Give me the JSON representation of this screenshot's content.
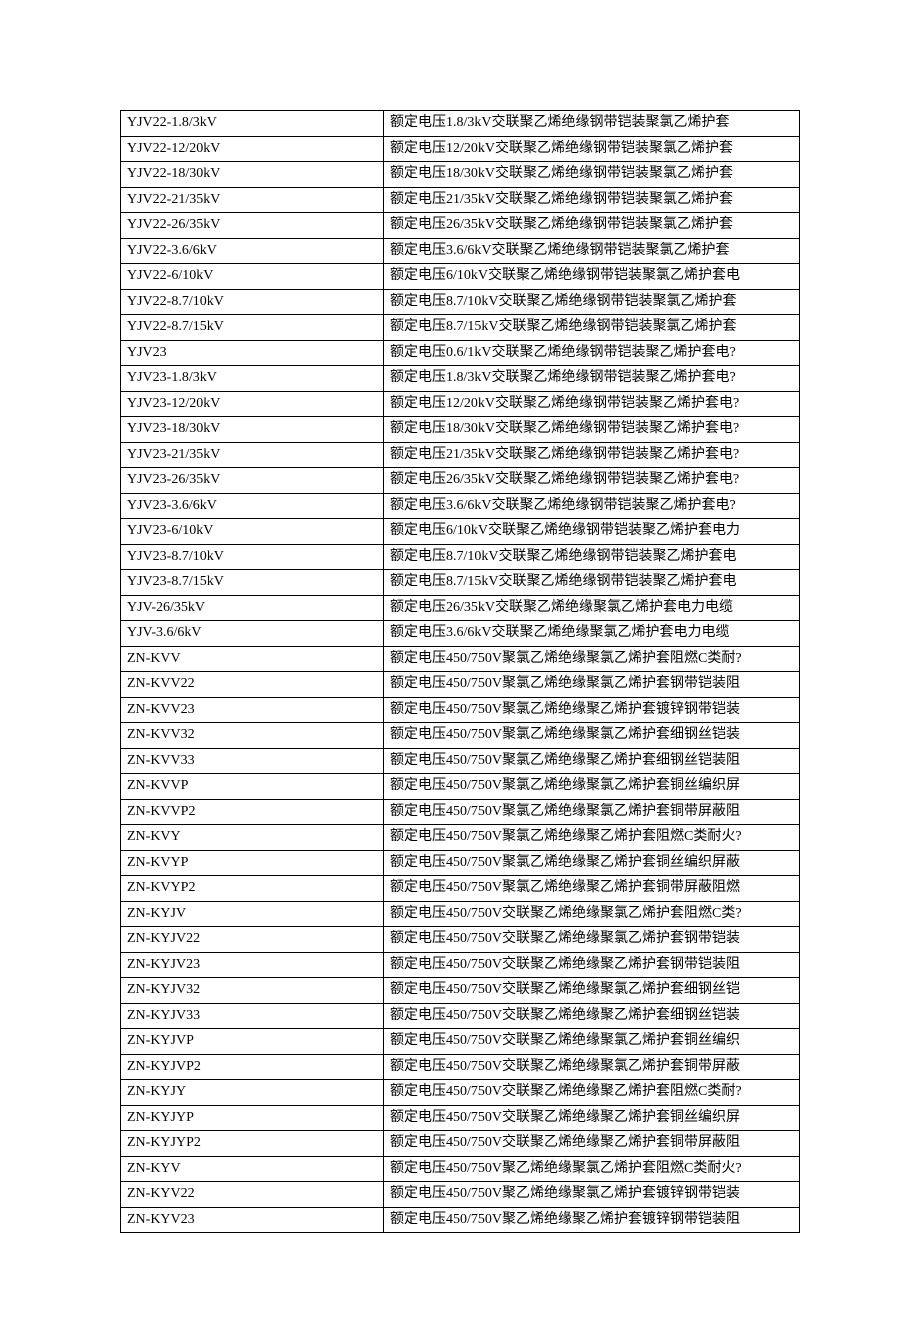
{
  "table": {
    "rows": [
      {
        "code": "YJV22-1.8/3kV",
        "desc": "额定电压1.8/3kV交联聚乙烯绝缘钢带铠装聚氯乙烯护套"
      },
      {
        "code": "YJV22-12/20kV",
        "desc": "额定电压12/20kV交联聚乙烯绝缘钢带铠装聚氯乙烯护套"
      },
      {
        "code": "YJV22-18/30kV",
        "desc": "额定电压18/30kV交联聚乙烯绝缘钢带铠装聚氯乙烯护套"
      },
      {
        "code": "YJV22-21/35kV",
        "desc": "额定电压21/35kV交联聚乙烯绝缘钢带铠装聚氯乙烯护套"
      },
      {
        "code": "YJV22-26/35kV",
        "desc": "额定电压26/35kV交联聚乙烯绝缘钢带铠装聚氯乙烯护套"
      },
      {
        "code": "YJV22-3.6/6kV",
        "desc": "额定电压3.6/6kV交联聚乙烯绝缘钢带铠装聚氯乙烯护套"
      },
      {
        "code": "YJV22-6/10kV",
        "desc": "额定电压6/10kV交联聚乙烯绝缘钢带铠装聚氯乙烯护套电"
      },
      {
        "code": "YJV22-8.7/10kV",
        "desc": "额定电压8.7/10kV交联聚乙烯绝缘钢带铠装聚氯乙烯护套"
      },
      {
        "code": "YJV22-8.7/15kV",
        "desc": "额定电压8.7/15kV交联聚乙烯绝缘钢带铠装聚氯乙烯护套"
      },
      {
        "code": "YJV23",
        "desc": "额定电压0.6/1kV交联聚乙烯绝缘钢带铠装聚乙烯护套电?"
      },
      {
        "code": "YJV23-1.8/3kV",
        "desc": "额定电压1.8/3kV交联聚乙烯绝缘钢带铠装聚乙烯护套电?"
      },
      {
        "code": "YJV23-12/20kV",
        "desc": "额定电压12/20kV交联聚乙烯绝缘钢带铠装聚乙烯护套电?"
      },
      {
        "code": "YJV23-18/30kV",
        "desc": "额定电压18/30kV交联聚乙烯绝缘钢带铠装聚乙烯护套电?"
      },
      {
        "code": "YJV23-21/35kV",
        "desc": "额定电压21/35kV交联聚乙烯绝缘钢带铠装聚乙烯护套电?"
      },
      {
        "code": "YJV23-26/35kV",
        "desc": "额定电压26/35kV交联聚乙烯绝缘钢带铠装聚乙烯护套电?"
      },
      {
        "code": "YJV23-3.6/6kV",
        "desc": "额定电压3.6/6kV交联聚乙烯绝缘钢带铠装聚乙烯护套电?"
      },
      {
        "code": "YJV23-6/10kV",
        "desc": "额定电压6/10kV交联聚乙烯绝缘钢带铠装聚乙烯护套电力"
      },
      {
        "code": "YJV23-8.7/10kV",
        "desc": "额定电压8.7/10kV交联聚乙烯绝缘钢带铠装聚乙烯护套电"
      },
      {
        "code": "YJV23-8.7/15kV",
        "desc": "额定电压8.7/15kV交联聚乙烯绝缘钢带铠装聚乙烯护套电"
      },
      {
        "code": "YJV-26/35kV",
        "desc": "额定电压26/35kV交联聚乙烯绝缘聚氯乙烯护套电力电缆"
      },
      {
        "code": "YJV-3.6/6kV",
        "desc": "额定电压3.6/6kV交联聚乙烯绝缘聚氯乙烯护套电力电缆"
      },
      {
        "code": "ZN-KVV",
        "desc": "额定电压450/750V聚氯乙烯绝缘聚氯乙烯护套阻燃C类耐?"
      },
      {
        "code": "ZN-KVV22",
        "desc": "额定电压450/750V聚氯乙烯绝缘聚氯乙烯护套钢带铠装阻"
      },
      {
        "code": "ZN-KVV23",
        "desc": "额定电压450/750V聚氯乙烯绝缘聚乙烯护套镀锌钢带铠装"
      },
      {
        "code": "ZN-KVV32",
        "desc": "额定电压450/750V聚氯乙烯绝缘聚氯乙烯护套细钢丝铠装"
      },
      {
        "code": "ZN-KVV33",
        "desc": "额定电压450/750V聚氯乙烯绝缘聚乙烯护套细钢丝铠装阻"
      },
      {
        "code": "ZN-KVVP",
        "desc": "额定电压450/750V聚氯乙烯绝缘聚氯乙烯护套铜丝编织屏"
      },
      {
        "code": "ZN-KVVP2",
        "desc": "额定电压450/750V聚氯乙烯绝缘聚氯乙烯护套铜带屏蔽阻"
      },
      {
        "code": "ZN-KVY",
        "desc": "额定电压450/750V聚氯乙烯绝缘聚乙烯护套阻燃C类耐火?"
      },
      {
        "code": "ZN-KVYP",
        "desc": "额定电压450/750V聚氯乙烯绝缘聚乙烯护套铜丝编织屏蔽"
      },
      {
        "code": "ZN-KVYP2",
        "desc": "额定电压450/750V聚氯乙烯绝缘聚乙烯护套铜带屏蔽阻燃"
      },
      {
        "code": "ZN-KYJV",
        "desc": "额定电压450/750V交联聚乙烯绝缘聚氯乙烯护套阻燃C类?"
      },
      {
        "code": "ZN-KYJV22",
        "desc": "额定电压450/750V交联聚乙烯绝缘聚氯乙烯护套钢带铠装"
      },
      {
        "code": "ZN-KYJV23",
        "desc": "额定电压450/750V交联聚乙烯绝缘聚乙烯护套钢带铠装阻"
      },
      {
        "code": "ZN-KYJV32",
        "desc": "额定电压450/750V交联聚乙烯绝缘聚氯乙烯护套细钢丝铠"
      },
      {
        "code": "ZN-KYJV33",
        "desc": "额定电压450/750V交联聚乙烯绝缘聚乙烯护套细钢丝铠装"
      },
      {
        "code": "ZN-KYJVP",
        "desc": "额定电压450/750V交联聚乙烯绝缘聚氯乙烯护套铜丝编织"
      },
      {
        "code": "ZN-KYJVP2",
        "desc": "额定电压450/750V交联聚乙烯绝缘聚氯乙烯护套铜带屏蔽"
      },
      {
        "code": "ZN-KYJY",
        "desc": "额定电压450/750V交联聚乙烯绝缘聚乙烯护套阻燃C类耐?"
      },
      {
        "code": "ZN-KYJYP",
        "desc": "额定电压450/750V交联聚乙烯绝缘聚乙烯护套铜丝编织屏"
      },
      {
        "code": "ZN-KYJYP2",
        "desc": "额定电压450/750V交联聚乙烯绝缘聚乙烯护套铜带屏蔽阻"
      },
      {
        "code": "ZN-KYV",
        "desc": "额定电压450/750V聚乙烯绝缘聚氯乙烯护套阻燃C类耐火?"
      },
      {
        "code": "ZN-KYV22",
        "desc": "额定电压450/750V聚乙烯绝缘聚氯乙烯护套镀锌钢带铠装"
      },
      {
        "code": "ZN-KYV23",
        "desc": "额定电压450/750V聚乙烯绝缘聚乙烯护套镀锌钢带铠装阻"
      }
    ]
  }
}
